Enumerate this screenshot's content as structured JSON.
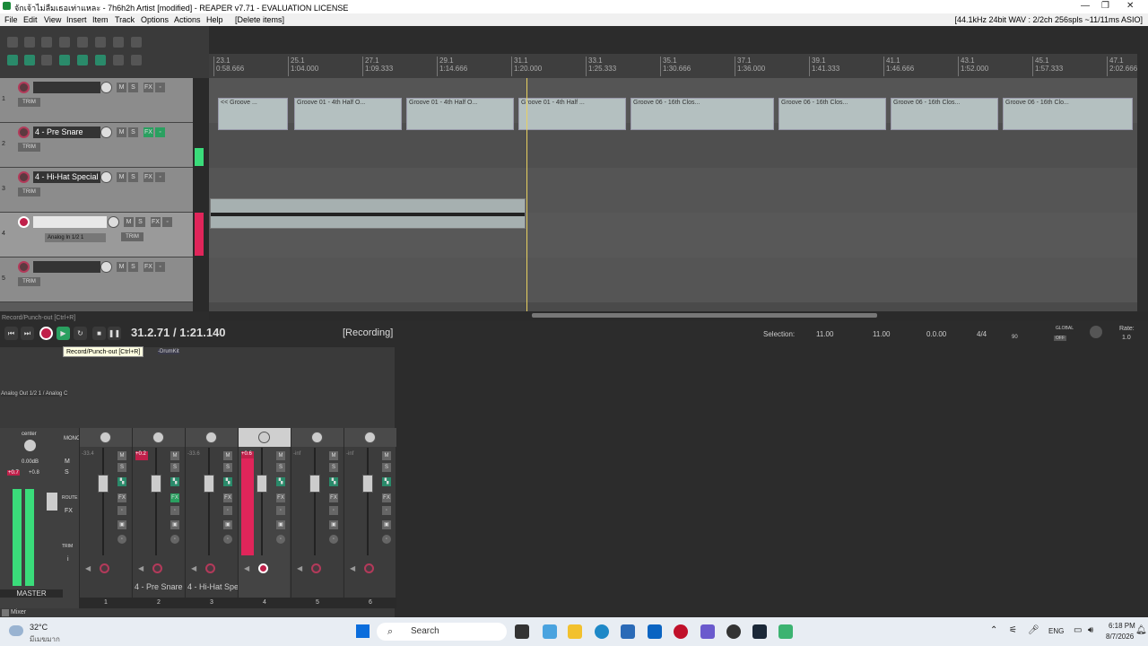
{
  "window": {
    "title": "จักเจ้าไม่ลืมเธอเท่าแหละ - 7h6h2h Artist [modified] - REAPER v7.71 - EVALUATION LICENSE",
    "audio_info": "[44.1kHz 24bit WAV : 2/2ch 256spls ~11/11ms ASIO]"
  },
  "menu": [
    "File",
    "Edit",
    "View",
    "Insert",
    "Item",
    "Track",
    "Options",
    "Actions",
    "Help",
    "[Delete items]"
  ],
  "ruler": [
    {
      "bar": "23.1",
      "time": "0:58.666"
    },
    {
      "bar": "25.1",
      "time": "1:04.000"
    },
    {
      "bar": "27.1",
      "time": "1:09.333"
    },
    {
      "bar": "29.1",
      "time": "1:14.666"
    },
    {
      "bar": "31.1",
      "time": "1:20.000"
    },
    {
      "bar": "33.1",
      "time": "1:25.333"
    },
    {
      "bar": "35.1",
      "time": "1:30.666"
    },
    {
      "bar": "37.1",
      "time": "1:36.000"
    },
    {
      "bar": "39.1",
      "time": "1:41.333"
    },
    {
      "bar": "41.1",
      "time": "1:46.666"
    },
    {
      "bar": "43.1",
      "time": "1:52.000"
    },
    {
      "bar": "45.1",
      "time": "1:57.333"
    },
    {
      "bar": "47.1",
      "time": "2:02.666"
    }
  ],
  "tracks": [
    {
      "num": "1",
      "name": ""
    },
    {
      "num": "2",
      "name": "4 - Pre Snare"
    },
    {
      "num": "3",
      "name": "4 - Hi-Hat Special"
    },
    {
      "num": "4",
      "name": "",
      "input": "Analog In 1/2 1"
    },
    {
      "num": "5",
      "name": ""
    }
  ],
  "midi_items": [
    "<< Groove ...",
    "Groove 01 - 4th Half O...",
    "Groove 01 - 4th Half O...",
    "Groove 01 - 4th Half ...",
    "Groove 06 - 16th Clos...",
    "Groove 06 - 16th Clos...",
    "Groove 06 - 16th Clos...",
    "Groove 06 - 16th Clo..."
  ],
  "transport": {
    "position": "31.2.71 / 1:21.140",
    "status": "[Recording]",
    "hint": "Record/Punch-out [Ctrl+R]",
    "tooltip": "Record/Punch-out [Ctrl+R]",
    "selection_label": "Selection:",
    "sel_start": "11.00",
    "sel_end": "11.00",
    "sel_len": "0.0.00",
    "timesig": "4/4",
    "bpm": "90",
    "global": "GLOBAL",
    "global_state": "OFF",
    "rate_label": "Rate:",
    "rate": "1.0"
  },
  "mixer": {
    "output_label": "Analog Out 1/2 1 / Analog C",
    "master": {
      "pan": "center",
      "vol": "0.00dB",
      "peak_l": "+0.7",
      "peak_r": "+0.8",
      "label": "MASTER",
      "buttons": [
        "M",
        "S",
        "ROUTE",
        "FX",
        "TRIM",
        "i"
      ],
      "mono": "MONO"
    },
    "strips": [
      {
        "num": "1",
        "name": "",
        "peak": "-33.4",
        "armed": false
      },
      {
        "num": "2",
        "name": "4 - Pre Snare",
        "peak": "+0.2",
        "armed": false
      },
      {
        "num": "3",
        "name": "4 - Hi-Hat Spe",
        "peak": "-33.6",
        "armed": false
      },
      {
        "num": "4",
        "name": "",
        "peak": "+0.6",
        "armed": true
      },
      {
        "num": "5",
        "name": "",
        "peak": "-inf",
        "armed": false
      },
      {
        "num": "6",
        "name": "",
        "peak": "-inf",
        "armed": false
      }
    ],
    "drumkit_label": "-DrumKit",
    "mixer_tab": "Mixer"
  },
  "taskbar": {
    "weather": "32°C",
    "weather_desc": "มีเมฆมาก",
    "search": "Search",
    "lang": "ENG",
    "time": "6:18 PM",
    "date": "8/7/2026"
  }
}
